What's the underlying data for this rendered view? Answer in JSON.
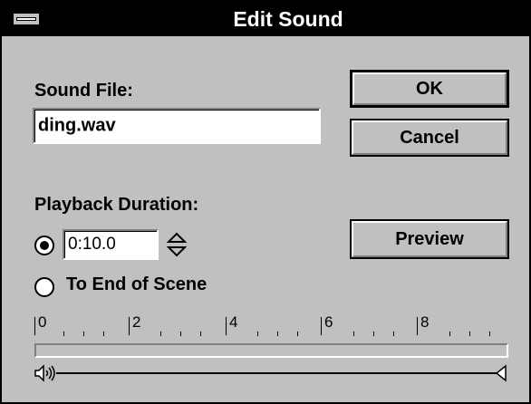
{
  "window": {
    "title": "Edit Sound"
  },
  "sound_file": {
    "label": "Sound File:",
    "value": "ding.wav"
  },
  "buttons": {
    "ok": "OK",
    "cancel": "Cancel",
    "preview": "Preview"
  },
  "playback": {
    "label": "Playback Duration:",
    "duration_value": "0:10.0",
    "duration_selected": true,
    "end_of_scene_label": "To End of Scene",
    "end_of_scene_selected": false
  },
  "ruler": {
    "labels": [
      "0",
      "2",
      "4",
      "6",
      "8"
    ]
  },
  "icons": {
    "system_menu": "system-menu-icon",
    "spinner": "spin-arrows-icon",
    "speaker": "speaker-icon",
    "end_marker": "end-marker-icon"
  }
}
